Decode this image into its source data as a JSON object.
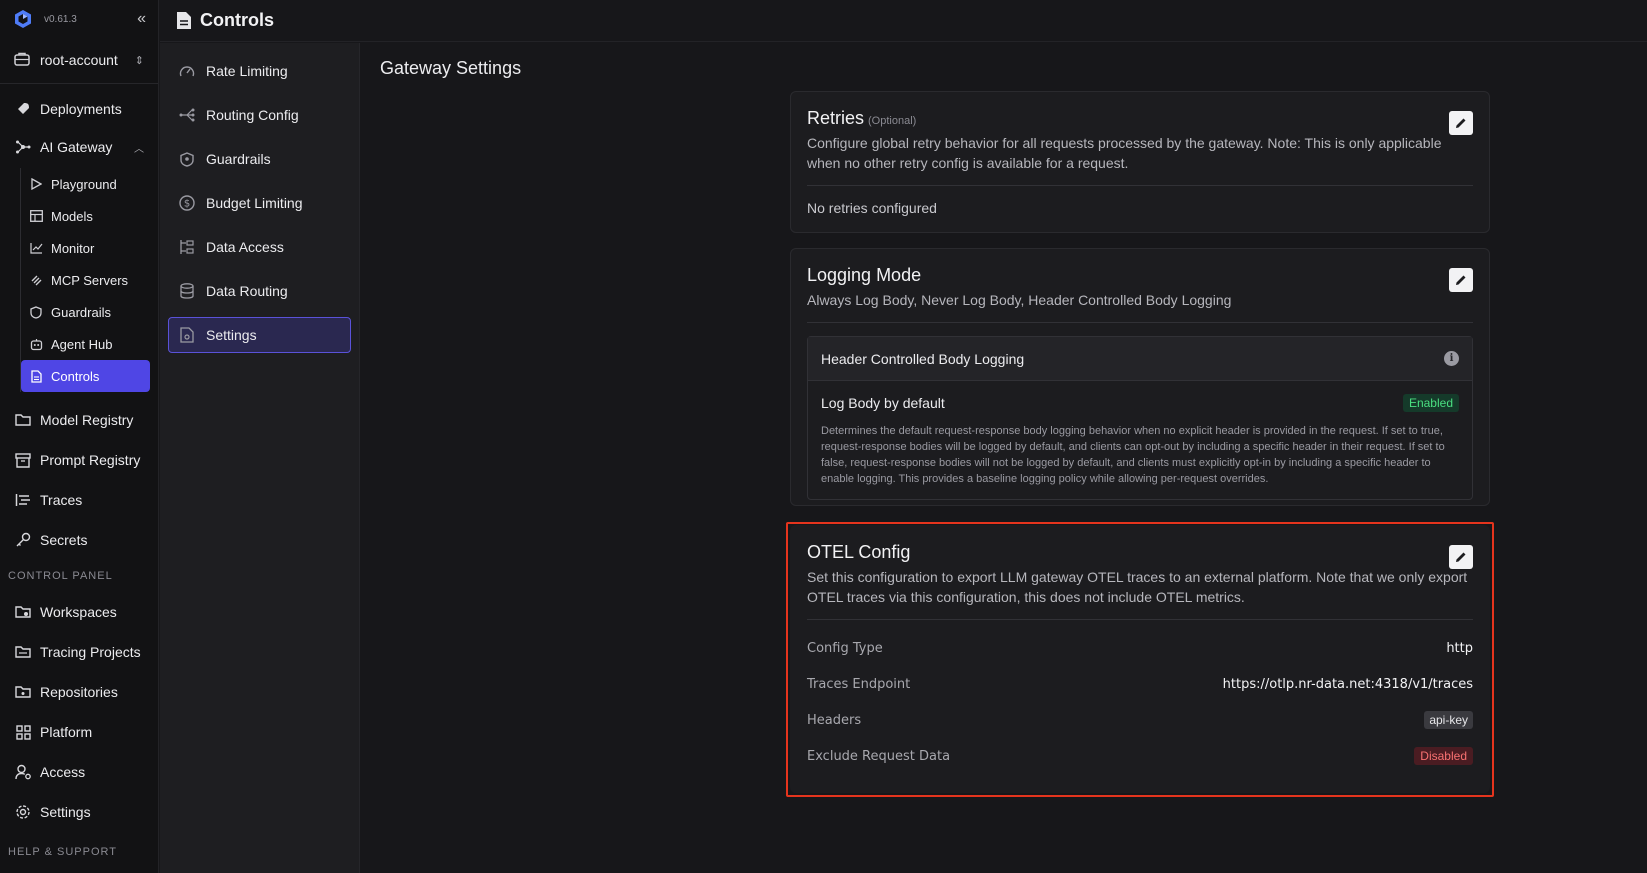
{
  "app": {
    "version": "v0.61.3"
  },
  "account": {
    "name": "root-account"
  },
  "sidebar": {
    "items_top": [
      {
        "label": "Deployments",
        "icon": "rocket-icon"
      }
    ],
    "ai_gateway": {
      "label": "AI Gateway",
      "children": [
        {
          "label": "Playground",
          "icon": "play-icon"
        },
        {
          "label": "Models",
          "icon": "table-icon"
        },
        {
          "label": "Monitor",
          "icon": "chart-icon"
        },
        {
          "label": "MCP Servers",
          "icon": "mcp-icon"
        },
        {
          "label": "Guardrails",
          "icon": "shield-icon"
        },
        {
          "label": "Agent Hub",
          "icon": "bot-icon"
        },
        {
          "label": "Controls",
          "icon": "document-icon"
        }
      ]
    },
    "items_bottom": [
      {
        "label": "Model Registry",
        "icon": "folder-icon"
      },
      {
        "label": "Prompt Registry",
        "icon": "archive-icon"
      },
      {
        "label": "Traces",
        "icon": "traces-icon"
      },
      {
        "label": "Secrets",
        "icon": "key-icon"
      }
    ],
    "control_panel_label": "CONTROL PANEL",
    "control_panel": [
      {
        "label": "Workspaces",
        "icon": "workspaces-icon"
      },
      {
        "label": "Tracing Projects",
        "icon": "tracing-icon"
      },
      {
        "label": "Repositories",
        "icon": "repo-icon"
      },
      {
        "label": "Platform",
        "icon": "grid-icon"
      },
      {
        "label": "Access",
        "icon": "user-gear-icon"
      },
      {
        "label": "Settings",
        "icon": "gear-icon"
      }
    ],
    "help_label": "HELP & SUPPORT"
  },
  "header": {
    "title": "Controls"
  },
  "subnav": {
    "items": [
      {
        "label": "Rate Limiting",
        "icon": "gauge-icon"
      },
      {
        "label": "Routing Config",
        "icon": "routing-icon"
      },
      {
        "label": "Guardrails",
        "icon": "shield-icon"
      },
      {
        "label": "Budget Limiting",
        "icon": "dollar-icon"
      },
      {
        "label": "Data Access",
        "icon": "data-access-icon"
      },
      {
        "label": "Data Routing",
        "icon": "database-icon"
      },
      {
        "label": "Settings",
        "icon": "settings-doc-icon"
      }
    ],
    "active_index": 6
  },
  "main": {
    "title": "Gateway Settings",
    "retries": {
      "title": "Retries",
      "optional": "(Optional)",
      "description": "Configure global retry behavior for all requests processed by the gateway. Note: This is only applicable when no other retry config is available for a request.",
      "note": "No retries configured"
    },
    "logging": {
      "title": "Logging Mode",
      "description": "Always Log Body, Never Log Body, Header Controlled Body Logging",
      "box_title": "Header Controlled Body Logging",
      "row_label": "Log Body by default",
      "row_status": "Enabled",
      "row_text": "Determines the default request-response body logging behavior when no explicit header is provided in the request. If set to true, request-response bodies will be logged by default, and clients can opt-out by including a specific header in their request. If set to false, request-response bodies will not be logged by default, and clients must explicitly opt-in by including a specific header to enable logging. This provides a baseline logging policy while allowing per-request overrides."
    },
    "otel": {
      "title": "OTEL Config",
      "description": "Set this configuration to export LLM gateway OTEL traces to an external platform. Note that we only export OTEL traces via this configuration, this does not include OTEL metrics.",
      "rows": [
        {
          "key": "Config Type",
          "value": "http"
        },
        {
          "key": "Traces Endpoint",
          "value": "https://otlp.nr-data.net:4318/v1/traces"
        },
        {
          "key": "Headers",
          "value": "api-key"
        },
        {
          "key": "Exclude Request Data",
          "value": "Disabled"
        }
      ]
    }
  },
  "colors": {
    "accent": "#4f46e5",
    "highlight_outline": "#e5341d",
    "enabled": "#4ade80",
    "disabled": "#f87171"
  }
}
